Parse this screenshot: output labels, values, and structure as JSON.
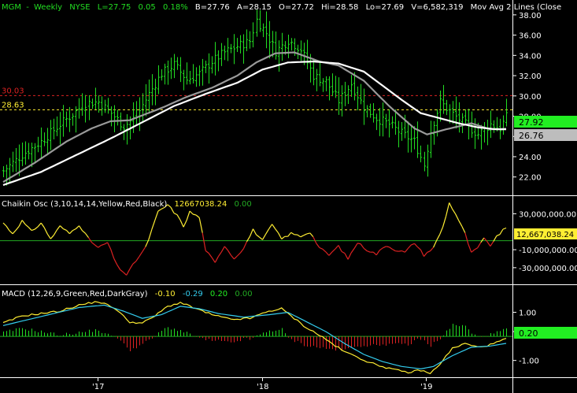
{
  "header": {
    "symbol": "MGM",
    "period": "Weekly",
    "exchange": "NYSE",
    "last": "L=27.75",
    "change": "0.05",
    "change_pct": "0.18%",
    "bid": "B=27.76",
    "ask": "A=28.15",
    "open": "O=27.72",
    "high": "Hi=28.58",
    "low": "Lo=27.69",
    "volume": "V=6,582,319",
    "study": "Mov Avg 2 Lines (Close"
  },
  "price_lines": {
    "red_label": "30.03",
    "yellow_label": "28.63",
    "red_value": 30.03,
    "yellow_value": 28.63
  },
  "price_tags": {
    "last": "27.92",
    "avg": "26.76"
  },
  "chaikin": {
    "label": "Chaikin Osc (3,10,14,14,Yellow,Red,Black)",
    "value": "12667038.24",
    "zero": "0.00",
    "tag": "12,667,038.24"
  },
  "macd": {
    "label": "MACD (12,26,9,Green,Red,DarkGray)",
    "v1": "-0.10",
    "v2": "-0.29",
    "v3": "0.20",
    "v4": "0.00",
    "tag": "0.20"
  },
  "x_axis": [
    "'17",
    "'18",
    "'19"
  ],
  "colors": {
    "bar": "#22dd22",
    "ma_fast": "#9a9a9a",
    "ma_slow": "#ffffff",
    "red": "#dd2222",
    "yellow": "#ffee33",
    "green_tag": "#22ee22",
    "cyan": "#33ccee"
  },
  "chart_data": [
    {
      "type": "ohlc",
      "title": "MGM Weekly NYSE",
      "ylim": [
        20.5,
        39
      ],
      "yticks": [
        "38.00",
        "36.00",
        "34.00",
        "32.00",
        "30.00",
        "28.00",
        "26.00",
        "24.00",
        "22.00"
      ],
      "ytick_values": [
        38,
        36,
        34,
        32,
        30,
        28,
        26,
        24,
        22
      ],
      "anchors_close": [
        [
          0,
          22.6
        ],
        [
          6,
          24.2
        ],
        [
          12,
          25.5
        ],
        [
          18,
          27.2
        ],
        [
          22,
          28.2
        ],
        [
          26,
          29.3
        ],
        [
          30,
          29.4
        ],
        [
          34,
          28.3
        ],
        [
          38,
          27.0
        ],
        [
          42,
          28.0
        ],
        [
          46,
          30.2
        ],
        [
          50,
          32.2
        ],
        [
          54,
          33.1
        ],
        [
          58,
          31.6
        ],
        [
          62,
          32.2
        ],
        [
          66,
          33.4
        ],
        [
          70,
          34.3
        ],
        [
          74,
          34.9
        ],
        [
          78,
          35.4
        ],
        [
          80,
          37.5
        ],
        [
          83,
          36.2
        ],
        [
          86,
          34.4
        ],
        [
          90,
          35.5
        ],
        [
          94,
          34.6
        ],
        [
          98,
          32.0
        ],
        [
          102,
          31.4
        ],
        [
          106,
          29.5
        ],
        [
          110,
          31.2
        ],
        [
          114,
          28.9
        ],
        [
          118,
          27.8
        ],
        [
          122,
          27.2
        ],
        [
          126,
          26.3
        ],
        [
          130,
          25.5
        ],
        [
          133,
          23.2
        ],
        [
          135,
          26.5
        ],
        [
          138,
          29.4
        ],
        [
          142,
          28.2
        ],
        [
          146,
          27.2
        ],
        [
          150,
          26.2
        ],
        [
          154,
          27.2
        ],
        [
          157,
          26.8
        ],
        [
          159,
          27.92
        ]
      ],
      "ma_fast": [
        [
          0,
          21.5
        ],
        [
          10,
          23.4
        ],
        [
          20,
          25.5
        ],
        [
          28,
          26.8
        ],
        [
          34,
          27.5
        ],
        [
          40,
          27.6
        ],
        [
          50,
          28.8
        ],
        [
          58,
          29.9
        ],
        [
          66,
          30.8
        ],
        [
          74,
          32.0
        ],
        [
          80,
          33.3
        ],
        [
          86,
          34.2
        ],
        [
          92,
          34.3
        ],
        [
          100,
          33.4
        ],
        [
          106,
          33.0
        ],
        [
          114,
          31.5
        ],
        [
          122,
          29.0
        ],
        [
          130,
          26.8
        ],
        [
          134,
          26.2
        ],
        [
          140,
          26.7
        ],
        [
          148,
          27.3
        ],
        [
          154,
          26.7
        ],
        [
          159,
          26.76
        ]
      ],
      "ma_slow": [
        [
          0,
          21.2
        ],
        [
          12,
          22.5
        ],
        [
          24,
          24.3
        ],
        [
          34,
          25.8
        ],
        [
          44,
          27.4
        ],
        [
          54,
          29.0
        ],
        [
          64,
          30.2
        ],
        [
          74,
          31.3
        ],
        [
          82,
          32.6
        ],
        [
          90,
          33.3
        ],
        [
          98,
          33.4
        ],
        [
          106,
          33.2
        ],
        [
          114,
          32.4
        ],
        [
          120,
          31.0
        ],
        [
          126,
          29.6
        ],
        [
          132,
          28.3
        ],
        [
          138,
          27.8
        ],
        [
          144,
          27.3
        ],
        [
          150,
          26.9
        ],
        [
          156,
          26.7
        ],
        [
          159,
          26.7
        ]
      ]
    },
    {
      "type": "line",
      "title": "Chaikin Osc",
      "ylim": [
        -45000000,
        47000000
      ],
      "yticks": [
        "30,000,000.00",
        "-10,000,000.00",
        "-30,000,000.00"
      ],
      "ytick_values": [
        30000000,
        -10000000,
        -30000000
      ],
      "series_anchors": [
        [
          0,
          20000000
        ],
        [
          3,
          8000000
        ],
        [
          6,
          22000000
        ],
        [
          9,
          10000000
        ],
        [
          12,
          20000000
        ],
        [
          15,
          2000000
        ],
        [
          18,
          16000000
        ],
        [
          21,
          8000000
        ],
        [
          24,
          18000000
        ],
        [
          27,
          2000000
        ],
        [
          30,
          -8000000
        ],
        [
          33,
          -2000000
        ],
        [
          36,
          -28000000
        ],
        [
          39,
          -38000000
        ],
        [
          42,
          -22000000
        ],
        [
          45,
          -8000000
        ],
        [
          47,
          12000000
        ],
        [
          49,
          32000000
        ],
        [
          52,
          40000000
        ],
        [
          55,
          28000000
        ],
        [
          57,
          16000000
        ],
        [
          59,
          32000000
        ],
        [
          62,
          26000000
        ],
        [
          64,
          -10000000
        ],
        [
          67,
          -25000000
        ],
        [
          70,
          -5000000
        ],
        [
          73,
          -20000000
        ],
        [
          76,
          -8000000
        ],
        [
          79,
          12000000
        ],
        [
          82,
          0
        ],
        [
          85,
          18000000
        ],
        [
          88,
          2000000
        ],
        [
          91,
          8000000
        ],
        [
          94,
          5000000
        ],
        [
          97,
          10000000
        ],
        [
          100,
          -8000000
        ],
        [
          103,
          -16000000
        ],
        [
          106,
          -6000000
        ],
        [
          109,
          -20000000
        ],
        [
          112,
          -2000000
        ],
        [
          115,
          -10000000
        ],
        [
          118,
          -15000000
        ],
        [
          121,
          -5000000
        ],
        [
          124,
          -10000000
        ],
        [
          127,
          -13000000
        ],
        [
          130,
          -2000000
        ],
        [
          133,
          -16000000
        ],
        [
          136,
          -8000000
        ],
        [
          139,
          15000000
        ],
        [
          141,
          42000000
        ],
        [
          143,
          30000000
        ],
        [
          146,
          8000000
        ],
        [
          148,
          -14000000
        ],
        [
          150,
          -8000000
        ],
        [
          152,
          2000000
        ],
        [
          154,
          -5000000
        ],
        [
          156,
          4000000
        ],
        [
          158,
          12000000
        ],
        [
          159,
          12667038
        ]
      ]
    },
    {
      "type": "line",
      "title": "MACD",
      "ylim": [
        -1.6,
        2.0
      ],
      "yticks": [
        "1.00",
        "0.20",
        "-1.00"
      ],
      "ytick_values": [
        1.0,
        0.2,
        -1.0
      ],
      "macd_line": [
        [
          0,
          0.55
        ],
        [
          6,
          0.85
        ],
        [
          12,
          0.95
        ],
        [
          18,
          1.05
        ],
        [
          24,
          1.3
        ],
        [
          30,
          1.45
        ],
        [
          35,
          1.2
        ],
        [
          40,
          0.6
        ],
        [
          44,
          0.55
        ],
        [
          48,
          0.85
        ],
        [
          52,
          1.25
        ],
        [
          56,
          1.4
        ],
        [
          60,
          1.2
        ],
        [
          66,
          0.9
        ],
        [
          72,
          0.7
        ],
        [
          78,
          0.75
        ],
        [
          84,
          1.05
        ],
        [
          88,
          1.15
        ],
        [
          92,
          0.75
        ],
        [
          96,
          0.35
        ],
        [
          100,
          0.05
        ],
        [
          104,
          -0.3
        ],
        [
          108,
          -0.65
        ],
        [
          112,
          -0.85
        ],
        [
          116,
          -1.1
        ],
        [
          120,
          -1.25
        ],
        [
          124,
          -1.4
        ],
        [
          128,
          -1.5
        ],
        [
          132,
          -1.4
        ],
        [
          135,
          -1.55
        ],
        [
          138,
          -1.15
        ],
        [
          142,
          -0.5
        ],
        [
          146,
          -0.3
        ],
        [
          150,
          -0.45
        ],
        [
          154,
          -0.35
        ],
        [
          157,
          -0.2
        ],
        [
          159,
          -0.1
        ]
      ],
      "signal_line": [
        [
          0,
          0.45
        ],
        [
          8,
          0.7
        ],
        [
          16,
          0.95
        ],
        [
          24,
          1.2
        ],
        [
          32,
          1.3
        ],
        [
          38,
          1.05
        ],
        [
          44,
          0.75
        ],
        [
          50,
          0.9
        ],
        [
          56,
          1.25
        ],
        [
          62,
          1.15
        ],
        [
          68,
          0.95
        ],
        [
          76,
          0.8
        ],
        [
          84,
          0.9
        ],
        [
          90,
          1.0
        ],
        [
          96,
          0.6
        ],
        [
          102,
          0.2
        ],
        [
          108,
          -0.3
        ],
        [
          114,
          -0.75
        ],
        [
          120,
          -1.05
        ],
        [
          126,
          -1.25
        ],
        [
          132,
          -1.35
        ],
        [
          136,
          -1.25
        ],
        [
          142,
          -0.8
        ],
        [
          148,
          -0.45
        ],
        [
          154,
          -0.4
        ],
        [
          159,
          -0.29
        ]
      ]
    }
  ]
}
